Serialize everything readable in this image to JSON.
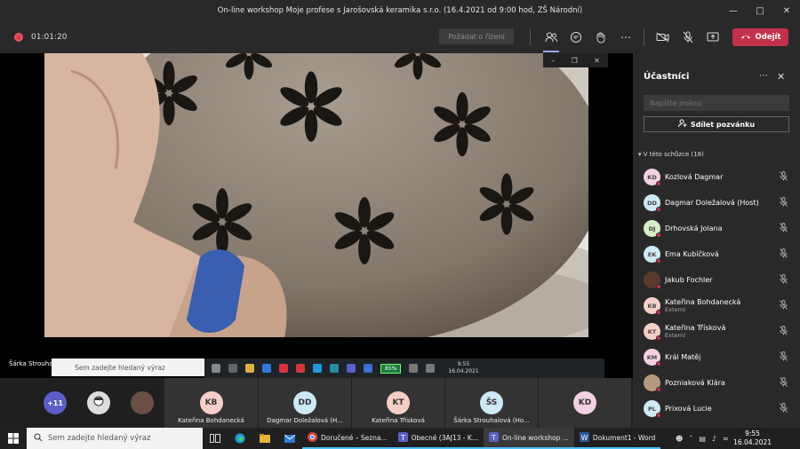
{
  "title": "On-line workshop Moje profese s Jarošovská keramika s.r.o. (16.4.2021 od 9:00 hod, ZŠ Národní)",
  "toolbar": {
    "recording_time": "01:01:20",
    "request_control": "Požádat o řízení",
    "leave": "Odejít"
  },
  "stage": {
    "presenter_label": "Šárka Strouhalová (Host)",
    "shared_search_placeholder": "Sem zadejte hledaný výraz",
    "shared_battery": "85%",
    "shared_time": "9:55",
    "shared_date": "16.04.2021"
  },
  "strip": {
    "overflow": "+11",
    "tiles": [
      {
        "initials": "KB",
        "name": "Kateřina Bohdanecká",
        "color": "#f6d0c8"
      },
      {
        "initials": "DD",
        "name": "Dagmar Doležalová (H...",
        "color": "#cde9f6"
      },
      {
        "initials": "KT",
        "name": "Kateřina Třísková",
        "color": "#f6cfc4"
      },
      {
        "initials": "ŠS",
        "name": "Šárka Strouhalová (Ho...",
        "color": "#cde9f6"
      },
      {
        "initials": "KD",
        "name": "",
        "color": "#f3d0e3"
      }
    ]
  },
  "panel": {
    "title": "Účastníci",
    "search_placeholder": "Napište jméno",
    "share_invite": "Sdílet pozvánku",
    "section": "V této schůzce (18)",
    "participants": [
      {
        "initials": "KD",
        "name": "Kozlová Dagmar",
        "sub": "",
        "color": "#f3d0e3"
      },
      {
        "initials": "DD",
        "name": "Dagmar Doležalová (Host)",
        "sub": "",
        "color": "#cde9f6"
      },
      {
        "initials": "DJ",
        "name": "Drhovská Jolana",
        "sub": "",
        "color": "#d8efc4"
      },
      {
        "initials": "EK",
        "name": "Ema Kubíčková",
        "sub": "",
        "color": "#cde9f6"
      },
      {
        "initials": "",
        "name": "Jakub Fochler",
        "sub": "",
        "color": "#5a3a2a"
      },
      {
        "initials": "KB",
        "name": "Kateřina Bohdanecká",
        "sub": "Externí",
        "color": "#f6d0c8"
      },
      {
        "initials": "KT",
        "name": "Kateřina Třísková",
        "sub": "Externí",
        "color": "#f6cfc4"
      },
      {
        "initials": "KM",
        "name": "Král Matěj",
        "sub": "",
        "color": "#f3d0e3"
      },
      {
        "initials": "",
        "name": "Pozniaková Klára",
        "sub": "",
        "color": "#b49a7c"
      },
      {
        "initials": "PL",
        "name": "Prixová Lucie",
        "sub": "",
        "color": "#cde9f6"
      }
    ]
  },
  "taskbar": {
    "search_placeholder": "Sem zadejte hledaný výraz",
    "apps": [
      {
        "label": "Doručené – Sezna..."
      },
      {
        "label": "Obecné (3AJ13 - K..."
      },
      {
        "label": "On-line workshop ..."
      },
      {
        "label": "Dokument1 - Word"
      }
    ],
    "time": "9:55",
    "date": "16.04.2021"
  }
}
